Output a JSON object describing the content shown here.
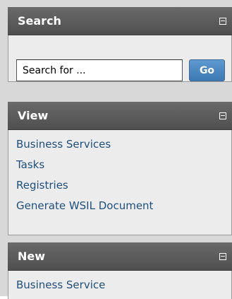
{
  "search": {
    "title": "Search",
    "placeholder": "Search for ...",
    "go_label": "Go"
  },
  "view": {
    "title": "View",
    "items": [
      "Business Services",
      "Tasks",
      "Registries",
      "Generate WSIL Document"
    ]
  },
  "new": {
    "title": "New",
    "items": [
      "Business Service"
    ]
  },
  "colors": {
    "header": "#5a5a5a",
    "panel_bg": "#ececec",
    "link": "#1f4f7f",
    "go_button": "#4a86c0"
  }
}
